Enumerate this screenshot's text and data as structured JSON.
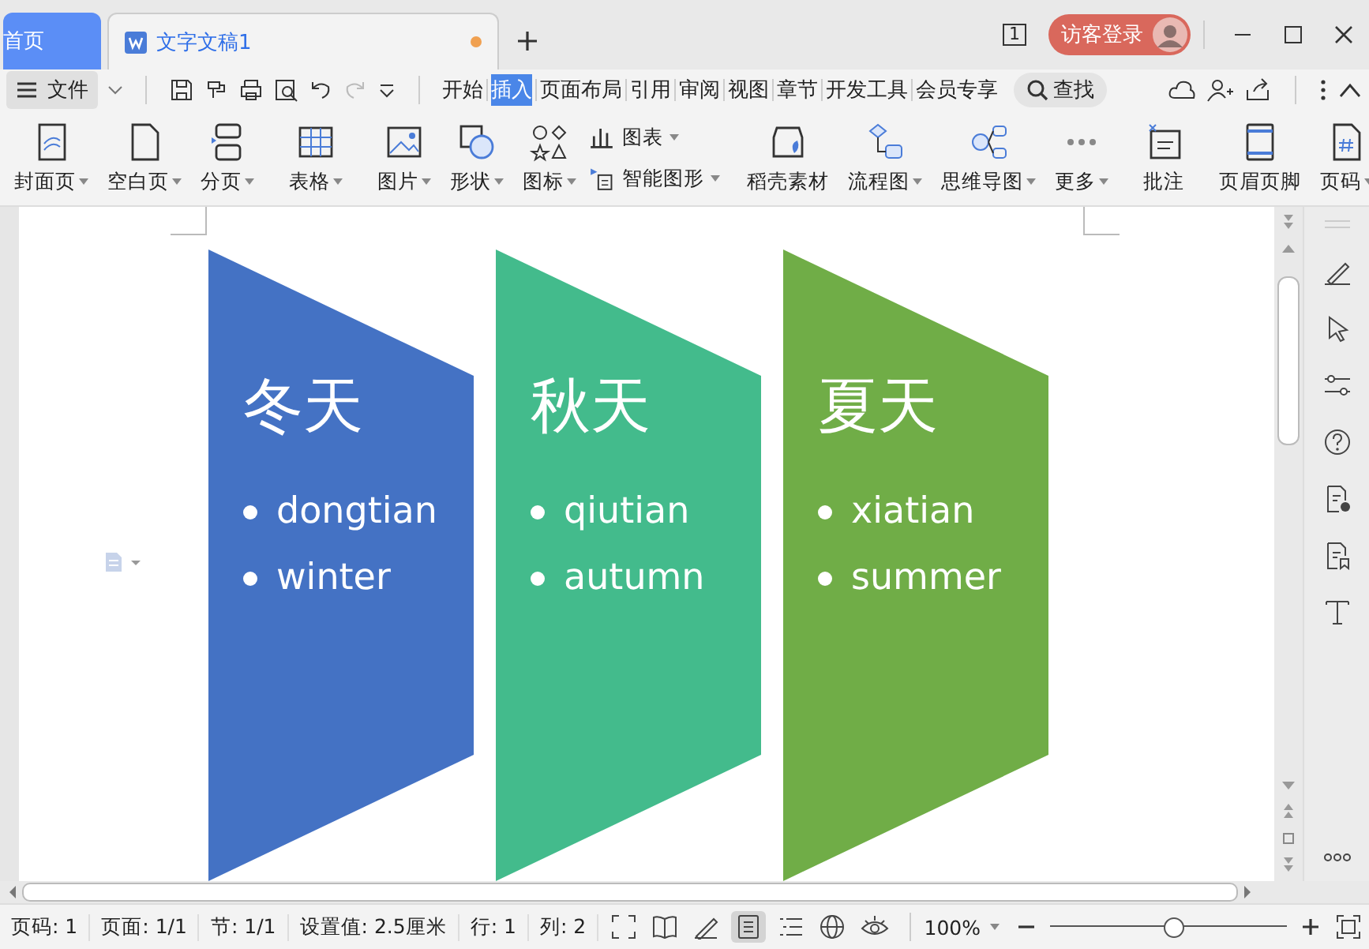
{
  "tabs": [
    {
      "label": "首页",
      "kind": "home",
      "selected": false
    },
    {
      "label": "文字文稿1",
      "kind": "doc",
      "selected": true,
      "modified": true
    }
  ],
  "account": {
    "badge": "1",
    "login": "访客登录"
  },
  "menu": {
    "file": "文件",
    "items": [
      {
        "label": "开始",
        "selected": false
      },
      {
        "label": "插入",
        "selected": true
      },
      {
        "label": "页面布局",
        "selected": false
      },
      {
        "label": "引用",
        "selected": false
      },
      {
        "label": "审阅",
        "selected": false
      },
      {
        "label": "视图",
        "selected": false
      },
      {
        "label": "章节",
        "selected": false
      },
      {
        "label": "开发工具",
        "selected": false
      },
      {
        "label": "会员专享",
        "selected": false
      }
    ],
    "search": "查找"
  },
  "ribbon": {
    "groups": [
      [
        {
          "label": "封面页",
          "kind": "large",
          "dropdown": true
        },
        {
          "label": "空白页",
          "kind": "large",
          "dropdown": true
        },
        {
          "label": "分页",
          "kind": "large",
          "dropdown": true
        }
      ],
      [
        {
          "label": "表格",
          "kind": "large",
          "dropdown": true
        }
      ],
      [
        {
          "label": "图片",
          "kind": "large",
          "dropdown": true
        },
        {
          "label": "形状",
          "kind": "large",
          "dropdown": true
        },
        {
          "label": "图标",
          "kind": "large",
          "dropdown": true
        },
        {
          "label": "图表",
          "kind": "small",
          "dropdown": true
        },
        {
          "label": "智能图形",
          "kind": "small",
          "dropdown": true
        }
      ],
      [
        {
          "label": "稻壳素材",
          "kind": "large",
          "dropdown": false
        },
        {
          "label": "流程图",
          "kind": "large",
          "dropdown": true
        },
        {
          "label": "思维导图",
          "kind": "large",
          "dropdown": true
        },
        {
          "label": "更多",
          "kind": "large",
          "dropdown": true
        }
      ],
      [
        {
          "label": "批注",
          "kind": "large",
          "dropdown": false
        }
      ],
      [
        {
          "label": "页眉页脚",
          "kind": "large",
          "dropdown": false
        },
        {
          "label": "页码",
          "kind": "large",
          "dropdown": true
        }
      ]
    ]
  },
  "diagram": [
    {
      "title": "冬天",
      "color": "#4472c4",
      "bullets": [
        "dongtian",
        "winter"
      ]
    },
    {
      "title": "秋天",
      "color": "#43bb8c",
      "bullets": [
        "qiutian",
        "autumn"
      ]
    },
    {
      "title": "夏天",
      "color": "#70ad47",
      "bullets": [
        "xiatian",
        "summer"
      ]
    }
  ],
  "status_bar": {
    "fields": [
      "页码: 1",
      "页面: 1/1",
      "节: 1/1",
      "设置值: 2.5厘米",
      "行: 1",
      "列: 2"
    ],
    "zoom": "100%",
    "zoom_slider": {
      "level": 0.52
    }
  }
}
